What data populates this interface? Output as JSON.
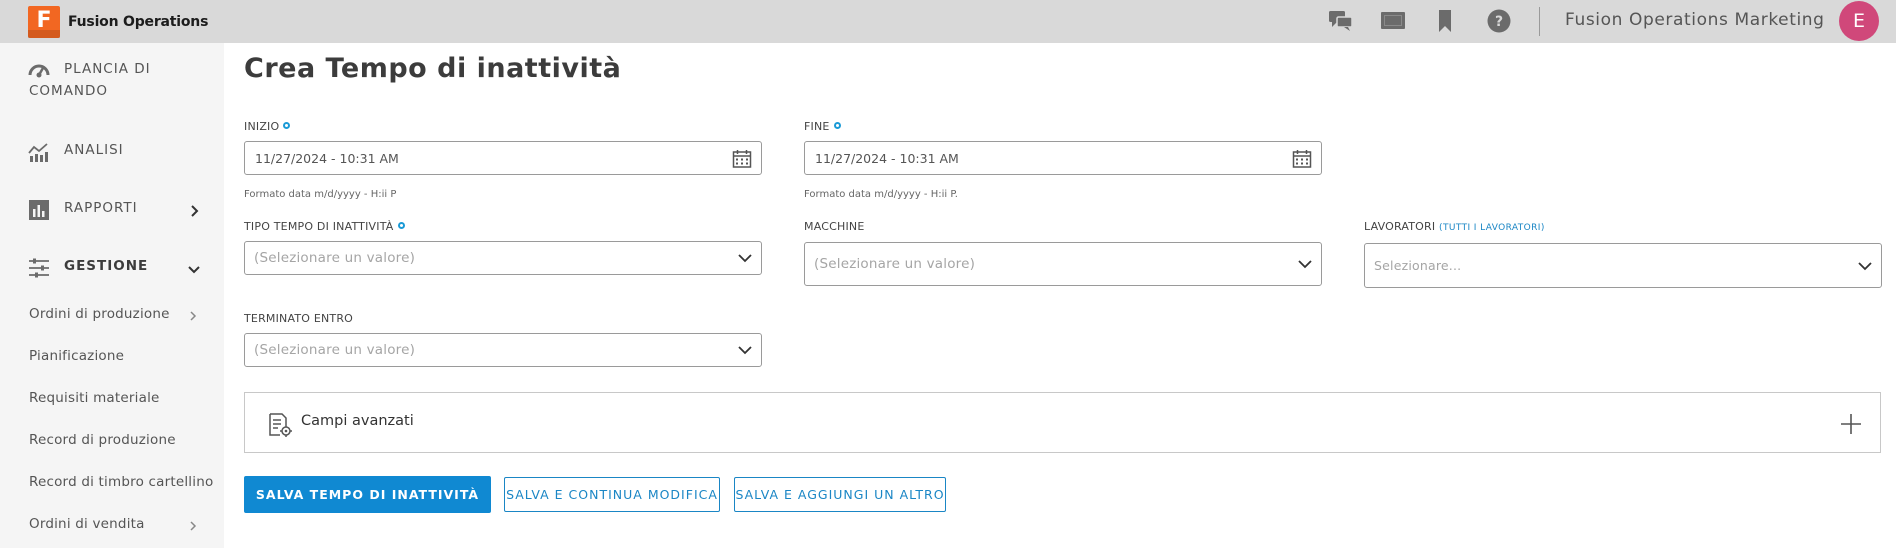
{
  "header": {
    "app_name": "Fusion Operations",
    "logo_letter": "F",
    "organization": "Fusion Operations Marketing",
    "avatar_initial": "E",
    "icons": [
      "chat-icon",
      "presentation-icon",
      "bookmark-icon",
      "help-icon"
    ]
  },
  "sidebar": {
    "items": [
      {
        "label_line1": "PLANCIA DI",
        "label_line2": "COMANDO",
        "icon": "gauge-icon"
      },
      {
        "label": "ANALISI",
        "icon": "analytics-icon"
      },
      {
        "label": "RAPPORTI",
        "icon": "reports-icon"
      },
      {
        "label": "GESTIONE",
        "icon": "sliders-icon"
      }
    ],
    "subitems": [
      {
        "label": "Ordini di produzione",
        "has_chevron": true
      },
      {
        "label": "Pianificazione"
      },
      {
        "label": "Requisiti materiale"
      },
      {
        "label": "Record di produzione"
      },
      {
        "label": "Record di timbro cartellino"
      },
      {
        "label": "Ordini di vendita",
        "has_chevron": true
      }
    ]
  },
  "form": {
    "title": "Crea Tempo di inattività",
    "start": {
      "label": "INIZIO",
      "value": "11/27/2024 - 10:31 AM",
      "hint": "Formato data m/d/yyyy - H:ii P"
    },
    "end": {
      "label": "FINE",
      "value": "11/27/2024 - 10:31 AM",
      "hint": "Formato data m/d/yyyy - H:ii P."
    },
    "downtime_type": {
      "label": "TIPO TEMPO DI INATTIVITÀ",
      "placeholder": "(Selezionare un valore)"
    },
    "machines": {
      "label": "MACCHINE",
      "placeholder": "(Selezionare un valore)"
    },
    "workers": {
      "label": "LAVORATORI",
      "link": "(TUTTI I LAVORATORI)",
      "placeholder": "Selezionare..."
    },
    "finished_by": {
      "label": "TERMINATO ENTRO",
      "placeholder": "(Selezionare un valore)"
    },
    "advanced": {
      "label": "Campi avanzati"
    },
    "buttons": {
      "save": "SALVA TEMPO DI INATTIVITÀ",
      "save_continue": "SALVA E CONTINUA MODIFICA",
      "save_add": "SALVA E AGGIUNGI UN ALTRO"
    }
  },
  "colors": {
    "primary": "#1089d2",
    "avatar": "#d0487a",
    "logo": "#f26722",
    "topbar": "#d9d9d9",
    "sidebar": "#f5f5f5"
  }
}
